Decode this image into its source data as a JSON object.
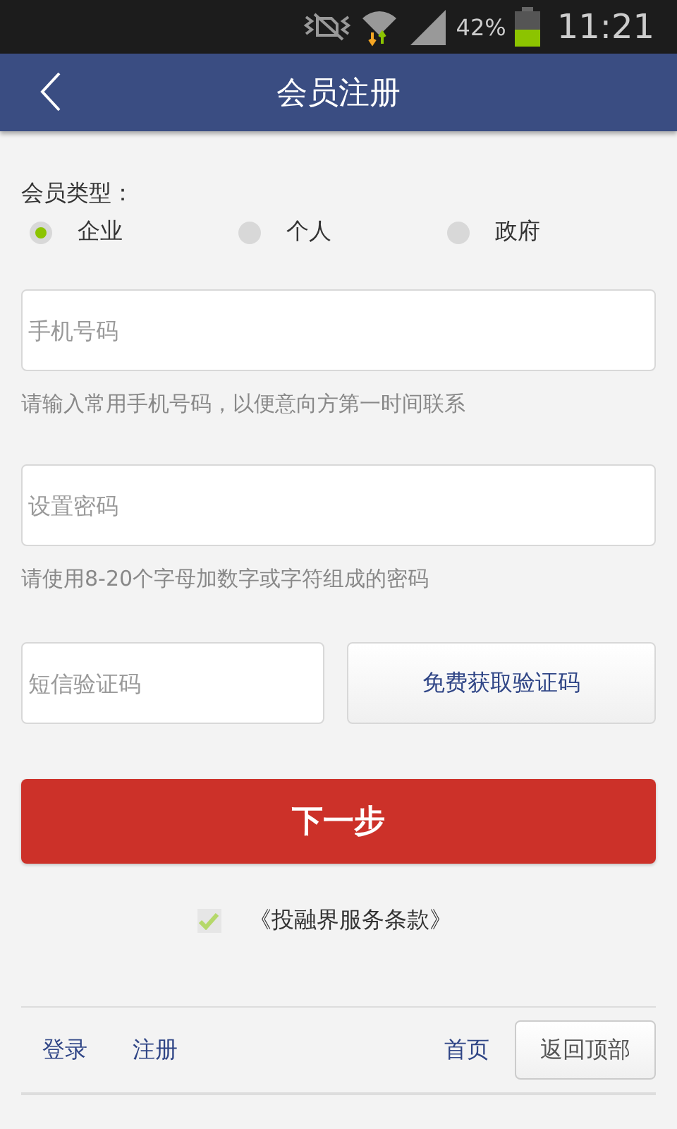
{
  "status_bar": {
    "battery_text": "42%",
    "time": "11:21"
  },
  "header": {
    "title": "会员注册"
  },
  "member_type": {
    "label": "会员类型：",
    "options": [
      {
        "label": "企业",
        "selected": true
      },
      {
        "label": "个人",
        "selected": false
      },
      {
        "label": "政府",
        "selected": false
      }
    ]
  },
  "phone": {
    "placeholder": "手机号码",
    "hint": "请输入常用手机号码，以便意向方第一时间联系"
  },
  "password": {
    "placeholder": "设置密码",
    "hint": "请使用8-20个字母加数字或字符组成的密码"
  },
  "sms": {
    "placeholder": "短信验证码",
    "button": "免费获取验证码"
  },
  "next_button": "下一步",
  "terms": {
    "checked": true,
    "label": "《投融界服务条款》"
  },
  "footer": {
    "left_links": [
      "登录",
      "注册"
    ],
    "home_link": "首页",
    "top_button": "返回顶部"
  }
}
